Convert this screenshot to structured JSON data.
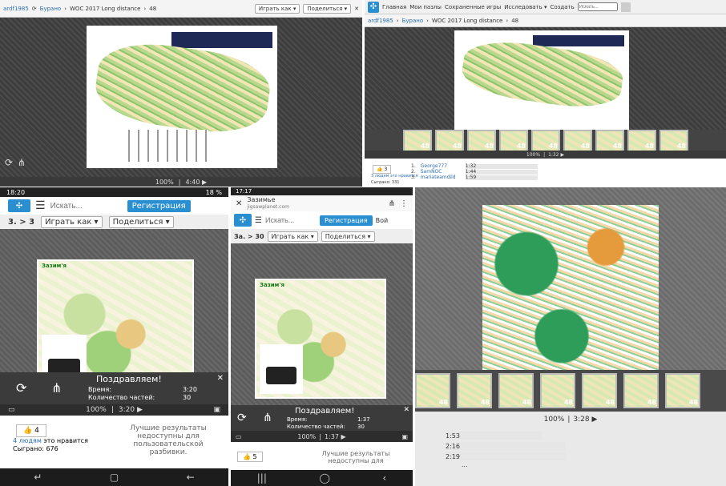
{
  "p1": {
    "user": "ardf1985",
    "sep1": "▶",
    "category": "Бурано",
    "title": "WOC 2017 Long distance",
    "count": "48",
    "play_as": "Играть как ▾",
    "share": "Поделиться ▾",
    "zoom": "100%",
    "time": "4:40 ▶"
  },
  "p2": {
    "user": "ardf1985",
    "category": "Бурано",
    "title": "WOC 2017 Long distance",
    "count": "48",
    "nav": [
      "Главная",
      "Мои пазлы",
      "Сохраненные игры",
      "Исследовать ▾",
      "Создать"
    ],
    "search_placeholder": "Искать...",
    "zoom": "100%",
    "time": "1:32 ▶",
    "thumb_label": "48",
    "likes": "3",
    "likes_text": "3 людям это нравится",
    "played": "Сыграно: 331",
    "leaderboard": [
      {
        "rank": "1.",
        "name": "George777",
        "time": "1:32"
      },
      {
        "rank": "2.",
        "name": "SamNOC",
        "time": "1:44"
      },
      {
        "rank": "3.",
        "name": "mariateamdild",
        "time": "1:59"
      }
    ]
  },
  "p3": {
    "status_time": "18:20",
    "status_right": "18 %",
    "search_placeholder": "Искать...",
    "register": "Регистрация",
    "breadcrumb": "3. > 3",
    "play_as": "Играть как ▾",
    "share": "Поделиться ▾",
    "map_title": "Зазим'я",
    "congrats": "Поздравляем!",
    "time_label": "Время:",
    "time_value": "3:20",
    "parts_label": "Количество частей:",
    "parts_value": "30",
    "zoom": "100%",
    "time": "3:20 ▶",
    "likes": "4",
    "likes_text_link": "4 людям",
    "likes_text_rest": "это нравится",
    "played": "Сыграно: 676",
    "best": "Лучшие результаты недоступны для пользовательской разбивки."
  },
  "p4": {
    "status_time": "17:17",
    "site_title": "Зазимье",
    "site_url": "jigsawplanet.com",
    "search_placeholder": "Искать...",
    "register": "Регистрация",
    "login": "Вой",
    "breadcrumb": "За. > 30",
    "play_as": "Играть как ▾",
    "share": "Поделиться ▾",
    "map_title": "Зазим'я",
    "congrats": "Поздравляем!",
    "time_label": "Время:",
    "time_value": "1:37",
    "parts_label": "Количество частей:",
    "parts_value": "30",
    "zoom": "100%",
    "time": "1:37 ▶",
    "likes": "5",
    "best": "Лучшие результаты недоступны для"
  },
  "p5": {
    "thumb_label": "48",
    "zoom": "100%",
    "time": "3:28 ▶",
    "times": [
      "1:53",
      "2:16",
      "2:19",
      "..."
    ]
  },
  "colors": {
    "accent": "#2a8fd0",
    "dark": "#3a3a3a"
  }
}
